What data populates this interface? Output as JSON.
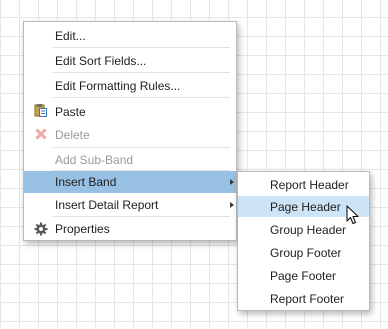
{
  "context_menu": {
    "items": [
      {
        "label": "Edit...",
        "enabled": true
      },
      {
        "label": "Edit Sort Fields...",
        "enabled": true
      },
      {
        "label": "Edit Formatting Rules...",
        "enabled": true
      },
      {
        "label": "Paste",
        "icon": "paste-icon",
        "enabled": true
      },
      {
        "label": "Delete",
        "icon": "delete-icon",
        "enabled": false
      },
      {
        "label": "Add Sub-Band",
        "enabled": false
      },
      {
        "label": "Insert Band",
        "submenu": true,
        "highlighted": true,
        "enabled": true
      },
      {
        "label": "Insert Detail Report",
        "submenu": true,
        "enabled": true
      },
      {
        "label": "Properties",
        "icon": "gear-icon",
        "enabled": true
      }
    ]
  },
  "insert_band_submenu": {
    "items": [
      {
        "label": "Report Header"
      },
      {
        "label": "Page Header",
        "hovered": true
      },
      {
        "label": "Group Header"
      },
      {
        "label": "Group Footer"
      },
      {
        "label": "Page Footer"
      },
      {
        "label": "Report Footer"
      }
    ]
  },
  "colors": {
    "highlight": "#97c0e3",
    "hover": "#cde3f6",
    "grid": "#e6e6e6",
    "disabled_text": "#9a9a9a"
  }
}
